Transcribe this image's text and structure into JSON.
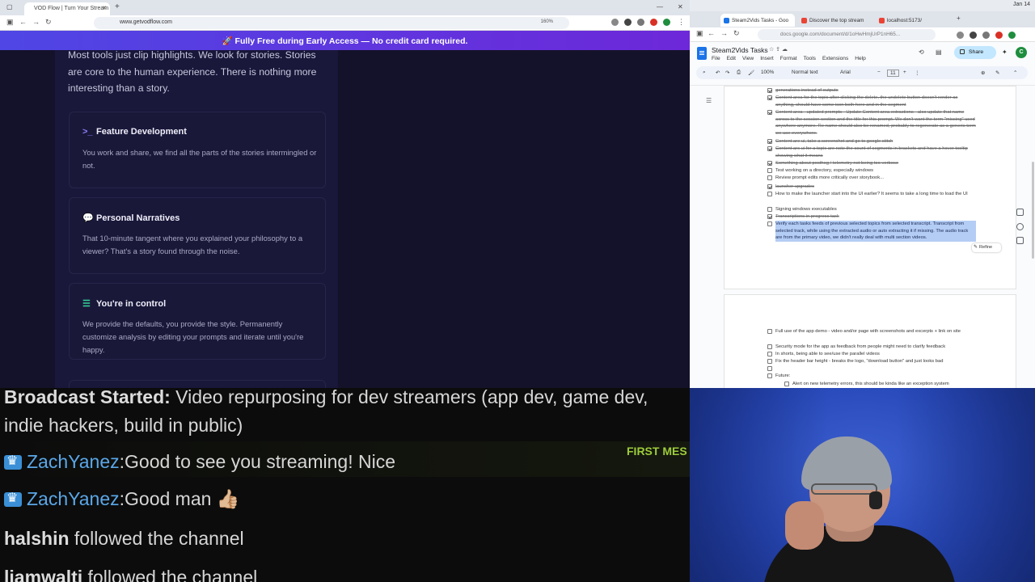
{
  "left_browser": {
    "tab_title": "VOD Flow | Turn Your Stream",
    "url": "www.getvodflow.com",
    "zoom": "160%",
    "banner": "🚀 Fully Free during Early Access — No credit card required.",
    "hero": "Most tools just clip highlights. We look for stories. Stories are core to the human experience. There is nothing more interesting than a story.",
    "cards": [
      {
        "icon": ">_",
        "title": "Feature Development",
        "body": "You work and share, we find all the parts of the stories intermingled or not.",
        "icon_color": "#8b7cf6"
      },
      {
        "icon": "💬",
        "title": "Personal Narratives",
        "body": "That 10-minute tangent where you explained your philosophy to a viewer? That's a story found through the noise.",
        "icon_color": "#a78bfa"
      },
      {
        "icon": "☰",
        "title": "You're in control",
        "body": "We provide the defaults, you provide the style. Permanently customize analysis by editing your prompts and iterate until you're happy.",
        "icon_color": "#34d399"
      }
    ]
  },
  "right_browser": {
    "os_date": "Jan 14",
    "tabs": [
      {
        "title": "Steam2Vids Tasks - Goo",
        "fav_color": "#1a73e8"
      },
      {
        "title": "Discover the top stream",
        "fav_color": "#ea4335"
      },
      {
        "title": "localhost:5173/",
        "fav_color": "#ea4335"
      }
    ],
    "url": "docs.google.com/document/d/1oHwHmjUrP1nH65...",
    "doc_title": "Steam2Vids Tasks",
    "menu": [
      "File",
      "Edit",
      "View",
      "Insert",
      "Format",
      "Tools",
      "Extensions",
      "Help"
    ],
    "share": "Share",
    "avatar_letter": "C",
    "toolbar": {
      "zoom": "100%",
      "style": "Normal text",
      "font": "Arial",
      "size": "11"
    },
    "tasks_page1": [
      {
        "text": "generations instead of outputs",
        "checked": true,
        "done": true
      },
      {
        "text": "Content area for the topic after clicking the delete, the undelete button doesn't render as anything, should have some icon both here and in the segment",
        "checked": true,
        "done": true
      },
      {
        "text": "Content area - updated prompts - Update Content area extractions - also update that name across to the session section and the title for this prompt. We don't want the term \"missing\" used anywhere anymore. Re-name should also be renamed, probably to regenerate as a generic term we use everywhere.",
        "checked": true,
        "done": true
      },
      {
        "text": "Content are ui, take a screenshot and go to google stitch",
        "checked": true,
        "done": true
      },
      {
        "text": "Content arc ui for a topic are note the count of segments in brackets and have a hover tooltip showing what it means",
        "checked": true,
        "done": true
      },
      {
        "text": "Something about posthog / telemetry not being too verbose",
        "checked": true,
        "done": true
      },
      {
        "text": "Test working on a directory, especially windows",
        "checked": false,
        "done": false
      },
      {
        "text": "Review prompt edits more critically over storybook...",
        "checked": false,
        "done": false
      },
      {
        "text": "launcher upgrades",
        "checked": true,
        "done": true
      },
      {
        "text": "How to make the launcher start into the UI earlier? It seems to take a long time to load the UI",
        "checked": false,
        "done": false
      },
      {
        "text": "Signing windows executables",
        "checked": false,
        "done": false
      },
      {
        "text": "Transcriptions in progress task",
        "checked": true,
        "done": true
      },
      {
        "text": "Verify each tasks feeds of previous selected topics from selected transcript. Transcript from selected track, while using the extracted audio or auto extracting it if missing. The audio track are from the primary video, we didn't really deal with multi section videos.",
        "checked": false,
        "done": false,
        "selected": true
      }
    ],
    "refine": "Refine",
    "tasks_page2": [
      {
        "text": "Full use of the app demo - video and/or page with screenshots and excerpts + link on site",
        "checked": false
      },
      {
        "text": "Security mode for the app as feedback from people might need to clarify feedback",
        "checked": false
      },
      {
        "text": "In shorts, being able to see/use the parallel videos",
        "checked": false
      },
      {
        "text": "Fix the header bar height - breaks the logo, \"download button\" and just looks bad",
        "checked": false
      },
      {
        "text": "",
        "checked": false
      },
      {
        "text": "Future:",
        "checked": false
      },
      {
        "text": "Alert on new telemetry errors, this should be kinda like an exception system",
        "checked": false
      }
    ]
  },
  "chat": {
    "broadcast_label": "Broadcast Started:",
    "broadcast_text": " Video repurposing for dev streamers (app dev, game dev,",
    "broadcast_text2": "indie hackers, build in public)",
    "first_msg": "FIRST MES",
    "messages": [
      {
        "user": "ZachYanez",
        "text": "Good to see you streaming! Nice"
      },
      {
        "user": "ZachYanez",
        "text": "Good man 👍🏼"
      }
    ],
    "follows": [
      {
        "user": "halshin",
        "text": " followed the channel"
      },
      {
        "user": "liamwalti",
        "text": " followed the channel"
      }
    ]
  }
}
